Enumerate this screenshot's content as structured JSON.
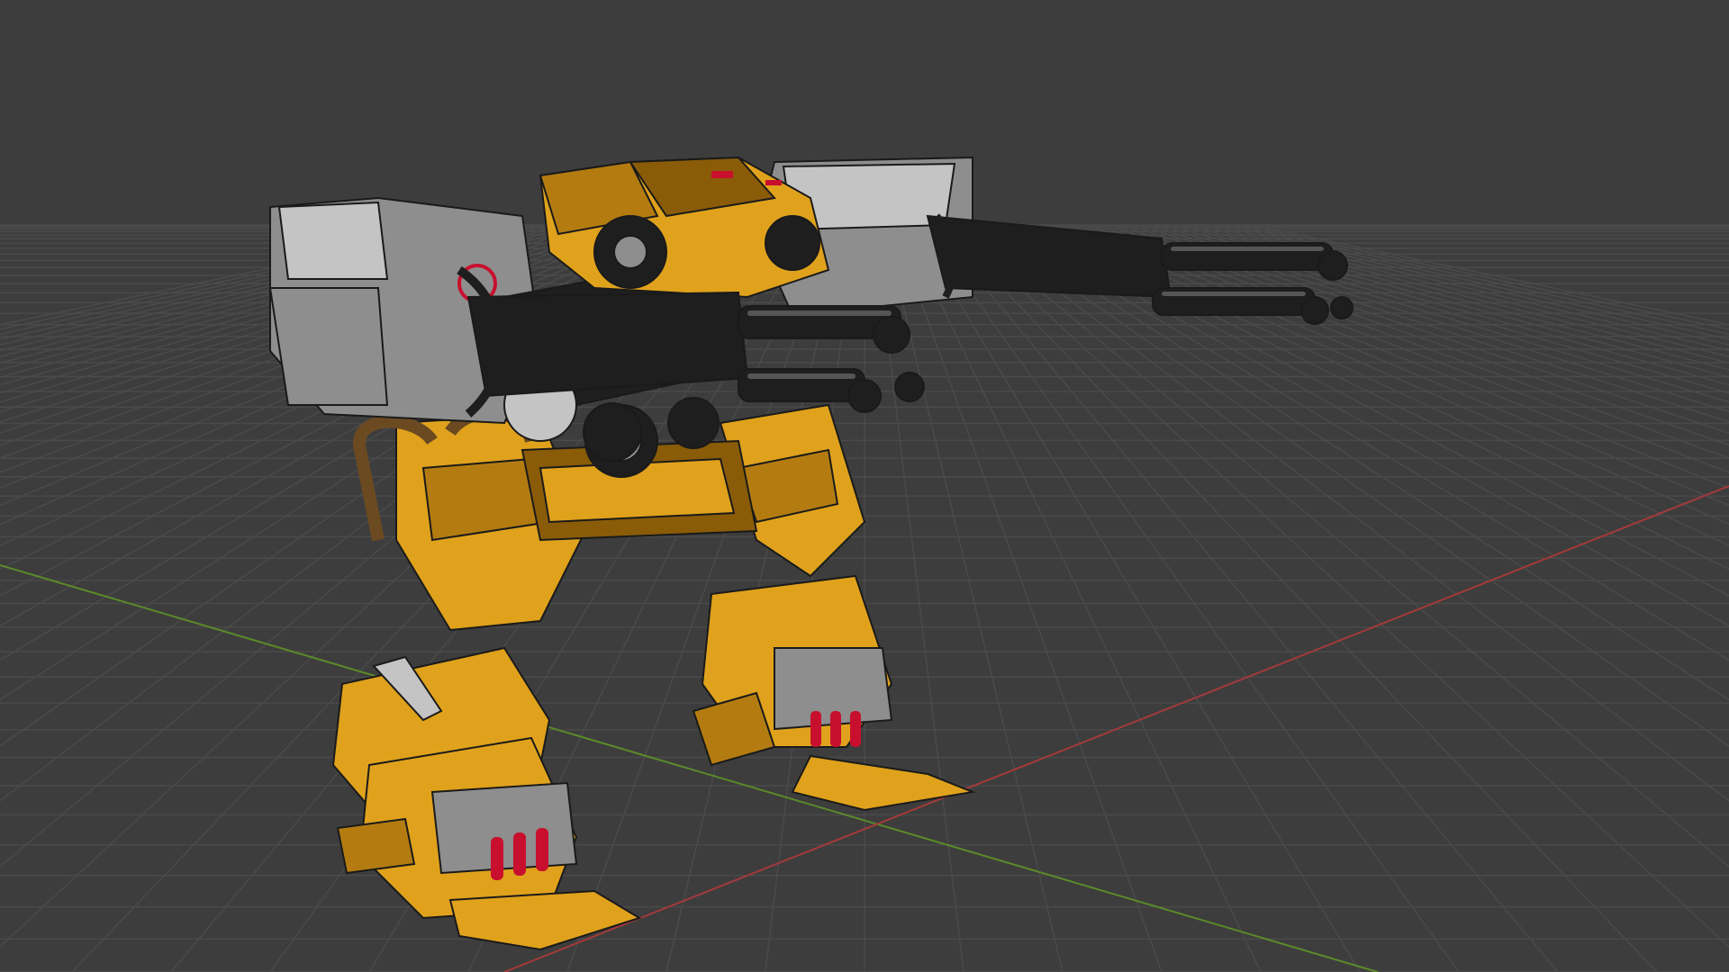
{
  "viewport": {
    "mode": "3d-perspective",
    "background_color": "#3d3d3d",
    "grid_color": "#4a4a4a",
    "x_axis_color": "#a33a3a",
    "y_axis_color": "#5b8a2a"
  },
  "model": {
    "icon": "mech-walker-model",
    "colors": {
      "hull": "#e0a21c",
      "hull_shade": "#b47c10",
      "hull_dark": "#8a5c08",
      "metal": "#8e8e8e",
      "metal_light": "#c4c4c4",
      "gun": "#1e1e1e",
      "gun_highlight": "#555555",
      "accent": "#c8102e"
    }
  }
}
